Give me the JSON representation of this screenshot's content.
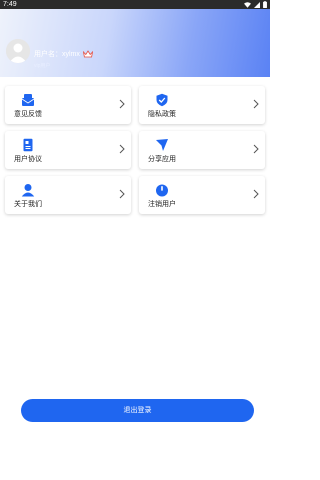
{
  "status_bar": {
    "time": "7:49"
  },
  "profile": {
    "username_label": "用户名：xylmx",
    "subtext": "vip用户",
    "accent": "#5a82f4"
  },
  "menu": {
    "feedback": "意见反馈",
    "privacy": "隐私政策",
    "agreement": "用户协议",
    "share": "分享应用",
    "about": "关于我们",
    "deregister": "注销用户"
  },
  "logout": {
    "label": "退出登录",
    "color": "#1f66f0"
  },
  "icons": [
    "mail-icon",
    "shield-check-icon",
    "document-icon",
    "send-icon",
    "user-icon",
    "power-icon",
    "chevron-right-icon",
    "crown-icon",
    "wifi-icon",
    "battery-icon"
  ]
}
